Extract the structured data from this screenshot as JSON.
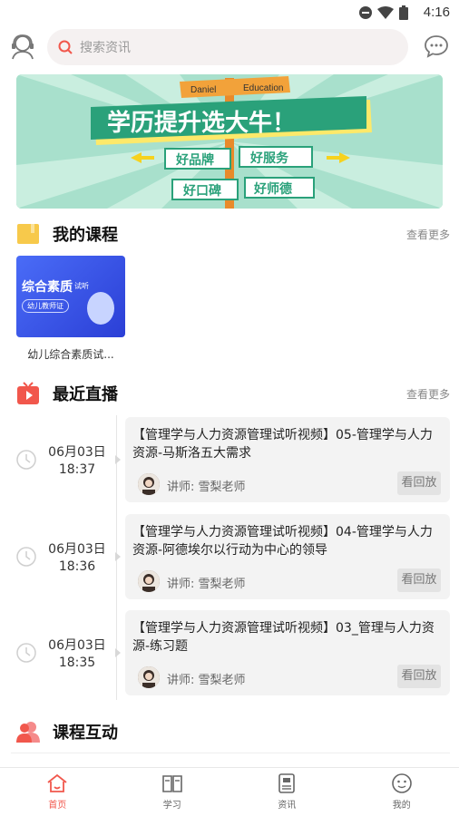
{
  "status_bar": {
    "time": "4:16"
  },
  "header": {
    "search_placeholder": "搜索资讯"
  },
  "banner": {
    "sign_top_left": "Daniel",
    "sign_top_right": "Education",
    "headline": "学历提升选大牛！",
    "tags": [
      "好品牌",
      "好服务",
      "好口碑",
      "好师德"
    ]
  },
  "my_courses": {
    "title": "我的课程",
    "more": "查看更多",
    "items": [
      {
        "name": "幼儿综合素质试...",
        "thumb_title": "综合素质",
        "thumb_sub": "试听",
        "thumb_badge": "幼儿教师证"
      }
    ]
  },
  "recent_live": {
    "title": "最近直播",
    "more": "查看更多",
    "items": [
      {
        "date": "06月03日",
        "time": "18:37",
        "title": "【管理学与人力资源管理试听视频】05-管理学与人力资源-马斯洛五大需求",
        "teacher": "讲师:  雪梨老师",
        "action": "看回放"
      },
      {
        "date": "06月03日",
        "time": "18:36",
        "title": "【管理学与人力资源管理试听视频】04-管理学与人力资源-阿德埃尔以行动为中心的领导",
        "teacher": "讲师:  雪梨老师",
        "action": "看回放"
      },
      {
        "date": "06月03日",
        "time": "18:35",
        "title": "【管理学与人力资源管理试听视频】03_管理与人力资源-练习题",
        "teacher": "讲师:  雪梨老师",
        "action": "看回放"
      }
    ]
  },
  "interaction": {
    "title": "课程互动"
  },
  "tabbar": {
    "tabs": [
      {
        "label": "首页",
        "icon": "home-icon",
        "active": true
      },
      {
        "label": "学习",
        "icon": "book-icon",
        "active": false
      },
      {
        "label": "资讯",
        "icon": "news-icon",
        "active": false
      },
      {
        "label": "我的",
        "icon": "profile-icon",
        "active": false
      }
    ]
  },
  "colors": {
    "accent": "#f1574c",
    "course_yellow": "#f7c94b",
    "banner_green": "#a8e0cc"
  }
}
